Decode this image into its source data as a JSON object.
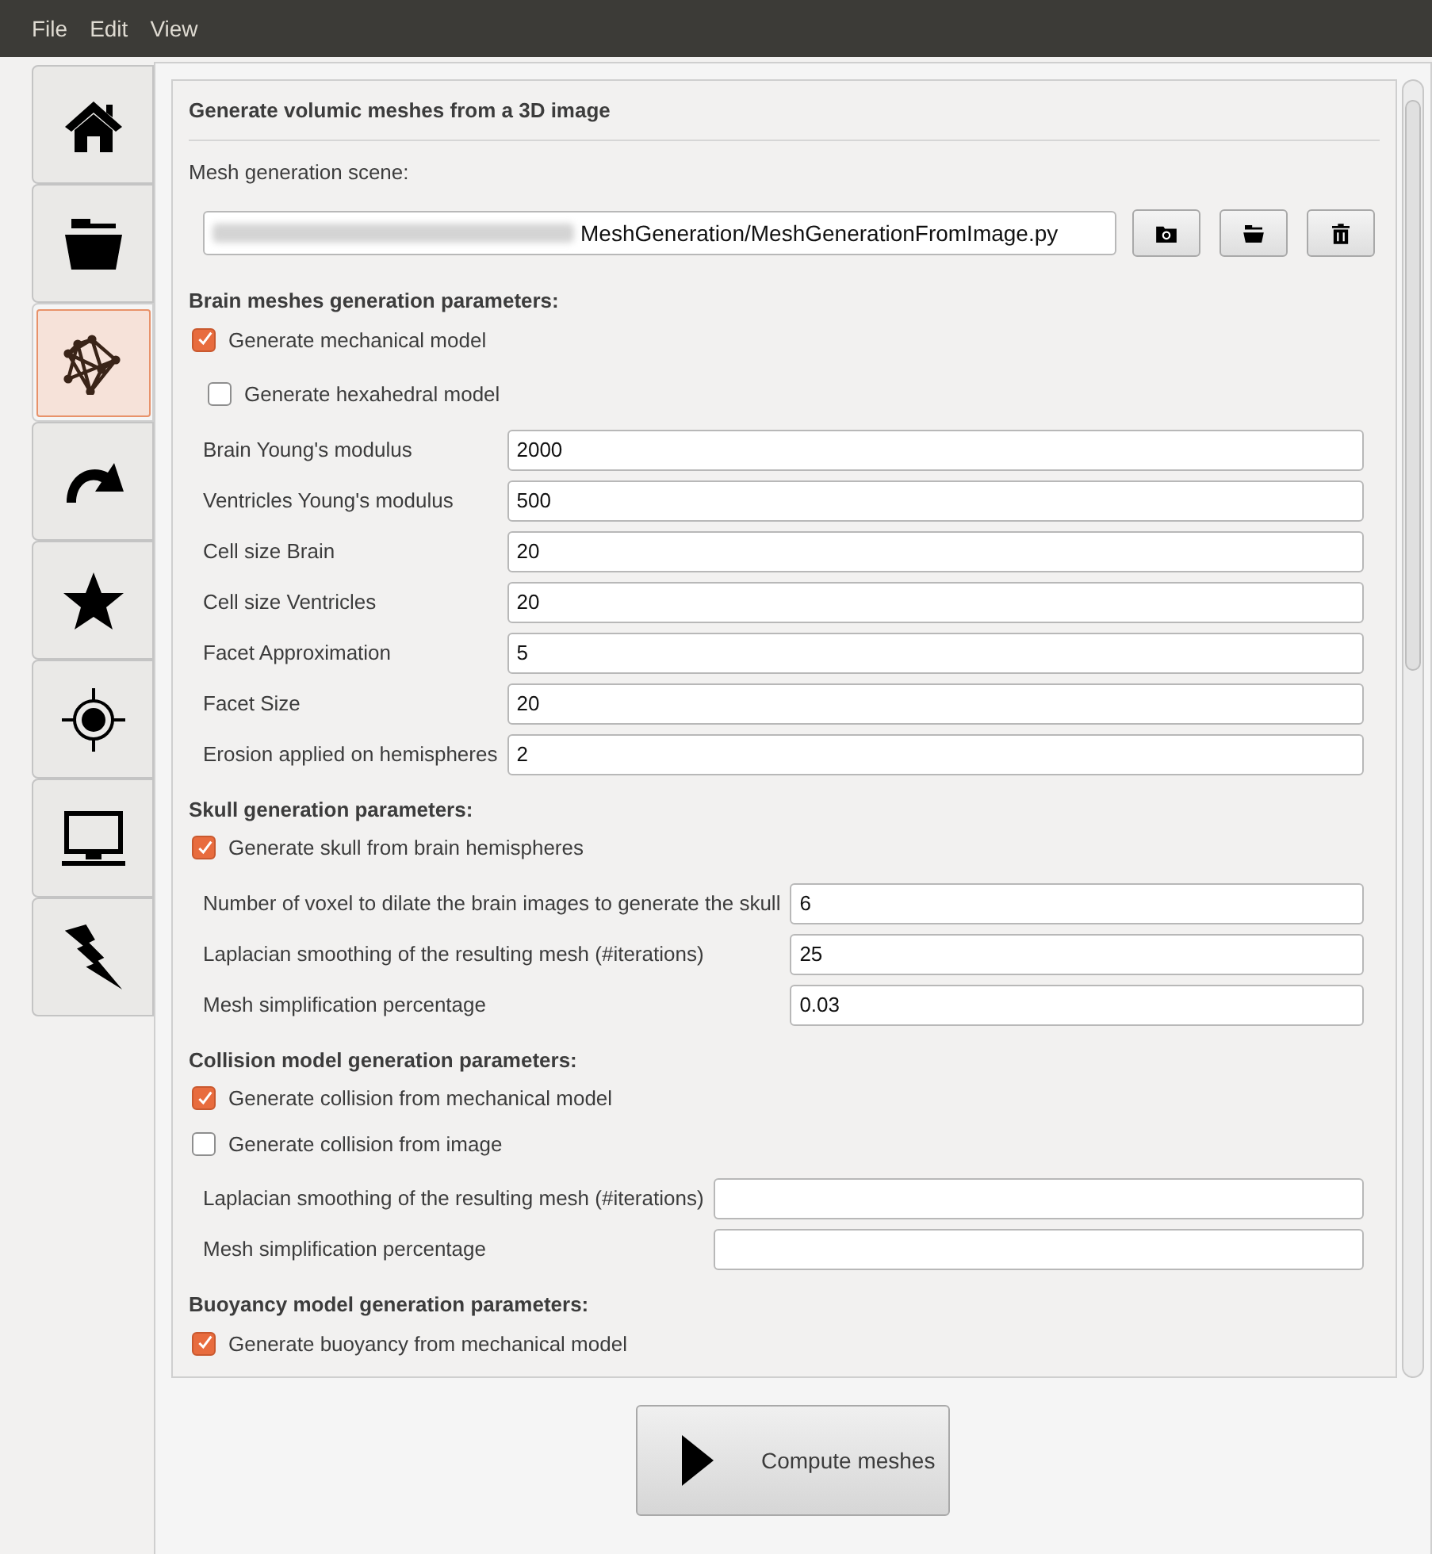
{
  "menu": [
    "File",
    "Edit",
    "View"
  ],
  "side_tabs": [
    {
      "selected": false
    },
    {
      "selected": false
    },
    {
      "selected": true
    },
    {
      "selected": false
    },
    {
      "selected": false
    },
    {
      "selected": false
    },
    {
      "selected": false
    },
    {
      "selected": false
    }
  ],
  "panel": {
    "title": "Generate volumic meshes from a 3D image",
    "scene_label": "Mesh generation scene:",
    "scene_path": "MeshGeneration/MeshGenerationFromImage.py"
  },
  "blocks": [
    {
      "kind": "heading",
      "text": "Brain meshes generation parameters:"
    },
    {
      "kind": "checkbox",
      "label": "Generate mechanical model",
      "checked": true,
      "indented": false
    },
    {
      "kind": "checkbox",
      "label": "Generate hexahedral model",
      "checked": false,
      "indented": true
    },
    {
      "kind": "fields",
      "rows": [
        {
          "label": "Brain Young's modulus",
          "value": "2000"
        },
        {
          "label": "Ventricles Young's modulus",
          "value": "500"
        },
        {
          "label": "Cell size Brain",
          "value": "20"
        },
        {
          "label": "Cell size Ventricles",
          "value": "20"
        },
        {
          "label": "Facet Approximation",
          "value": "5"
        },
        {
          "label": "Facet Size",
          "value": "20"
        },
        {
          "label": "Erosion applied on hemispheres",
          "value": "2"
        }
      ]
    },
    {
      "kind": "heading",
      "text": "Skull generation parameters:"
    },
    {
      "kind": "checkbox",
      "label": "Generate skull from brain hemispheres",
      "checked": true,
      "indented": false
    },
    {
      "kind": "fields",
      "rows": [
        {
          "label": "Number of voxel to dilate the brain images to generate the skull",
          "value": "6"
        },
        {
          "label": "Laplacian smoothing of the resulting mesh (#iterations)",
          "value": "25"
        },
        {
          "label": "Mesh simplification percentage",
          "value": "0.03"
        }
      ]
    },
    {
      "kind": "heading",
      "text": "Collision model generation parameters:"
    },
    {
      "kind": "checkbox",
      "label": "Generate collision from mechanical model",
      "checked": true,
      "indented": false
    },
    {
      "kind": "checkbox",
      "label": "Generate collision from image",
      "checked": false,
      "indented": false
    },
    {
      "kind": "fields",
      "rows": [
        {
          "label": "Laplacian smoothing of the resulting mesh (#iterations)"
        },
        {
          "label": "Mesh simplification percentage"
        }
      ]
    },
    {
      "kind": "heading",
      "text": "Buoyancy model generation parameters:"
    },
    {
      "kind": "checkbox",
      "label": "Generate buoyancy from mechanical model",
      "checked": true,
      "indented": false
    }
  ],
  "compute_button": "Compute meshes"
}
